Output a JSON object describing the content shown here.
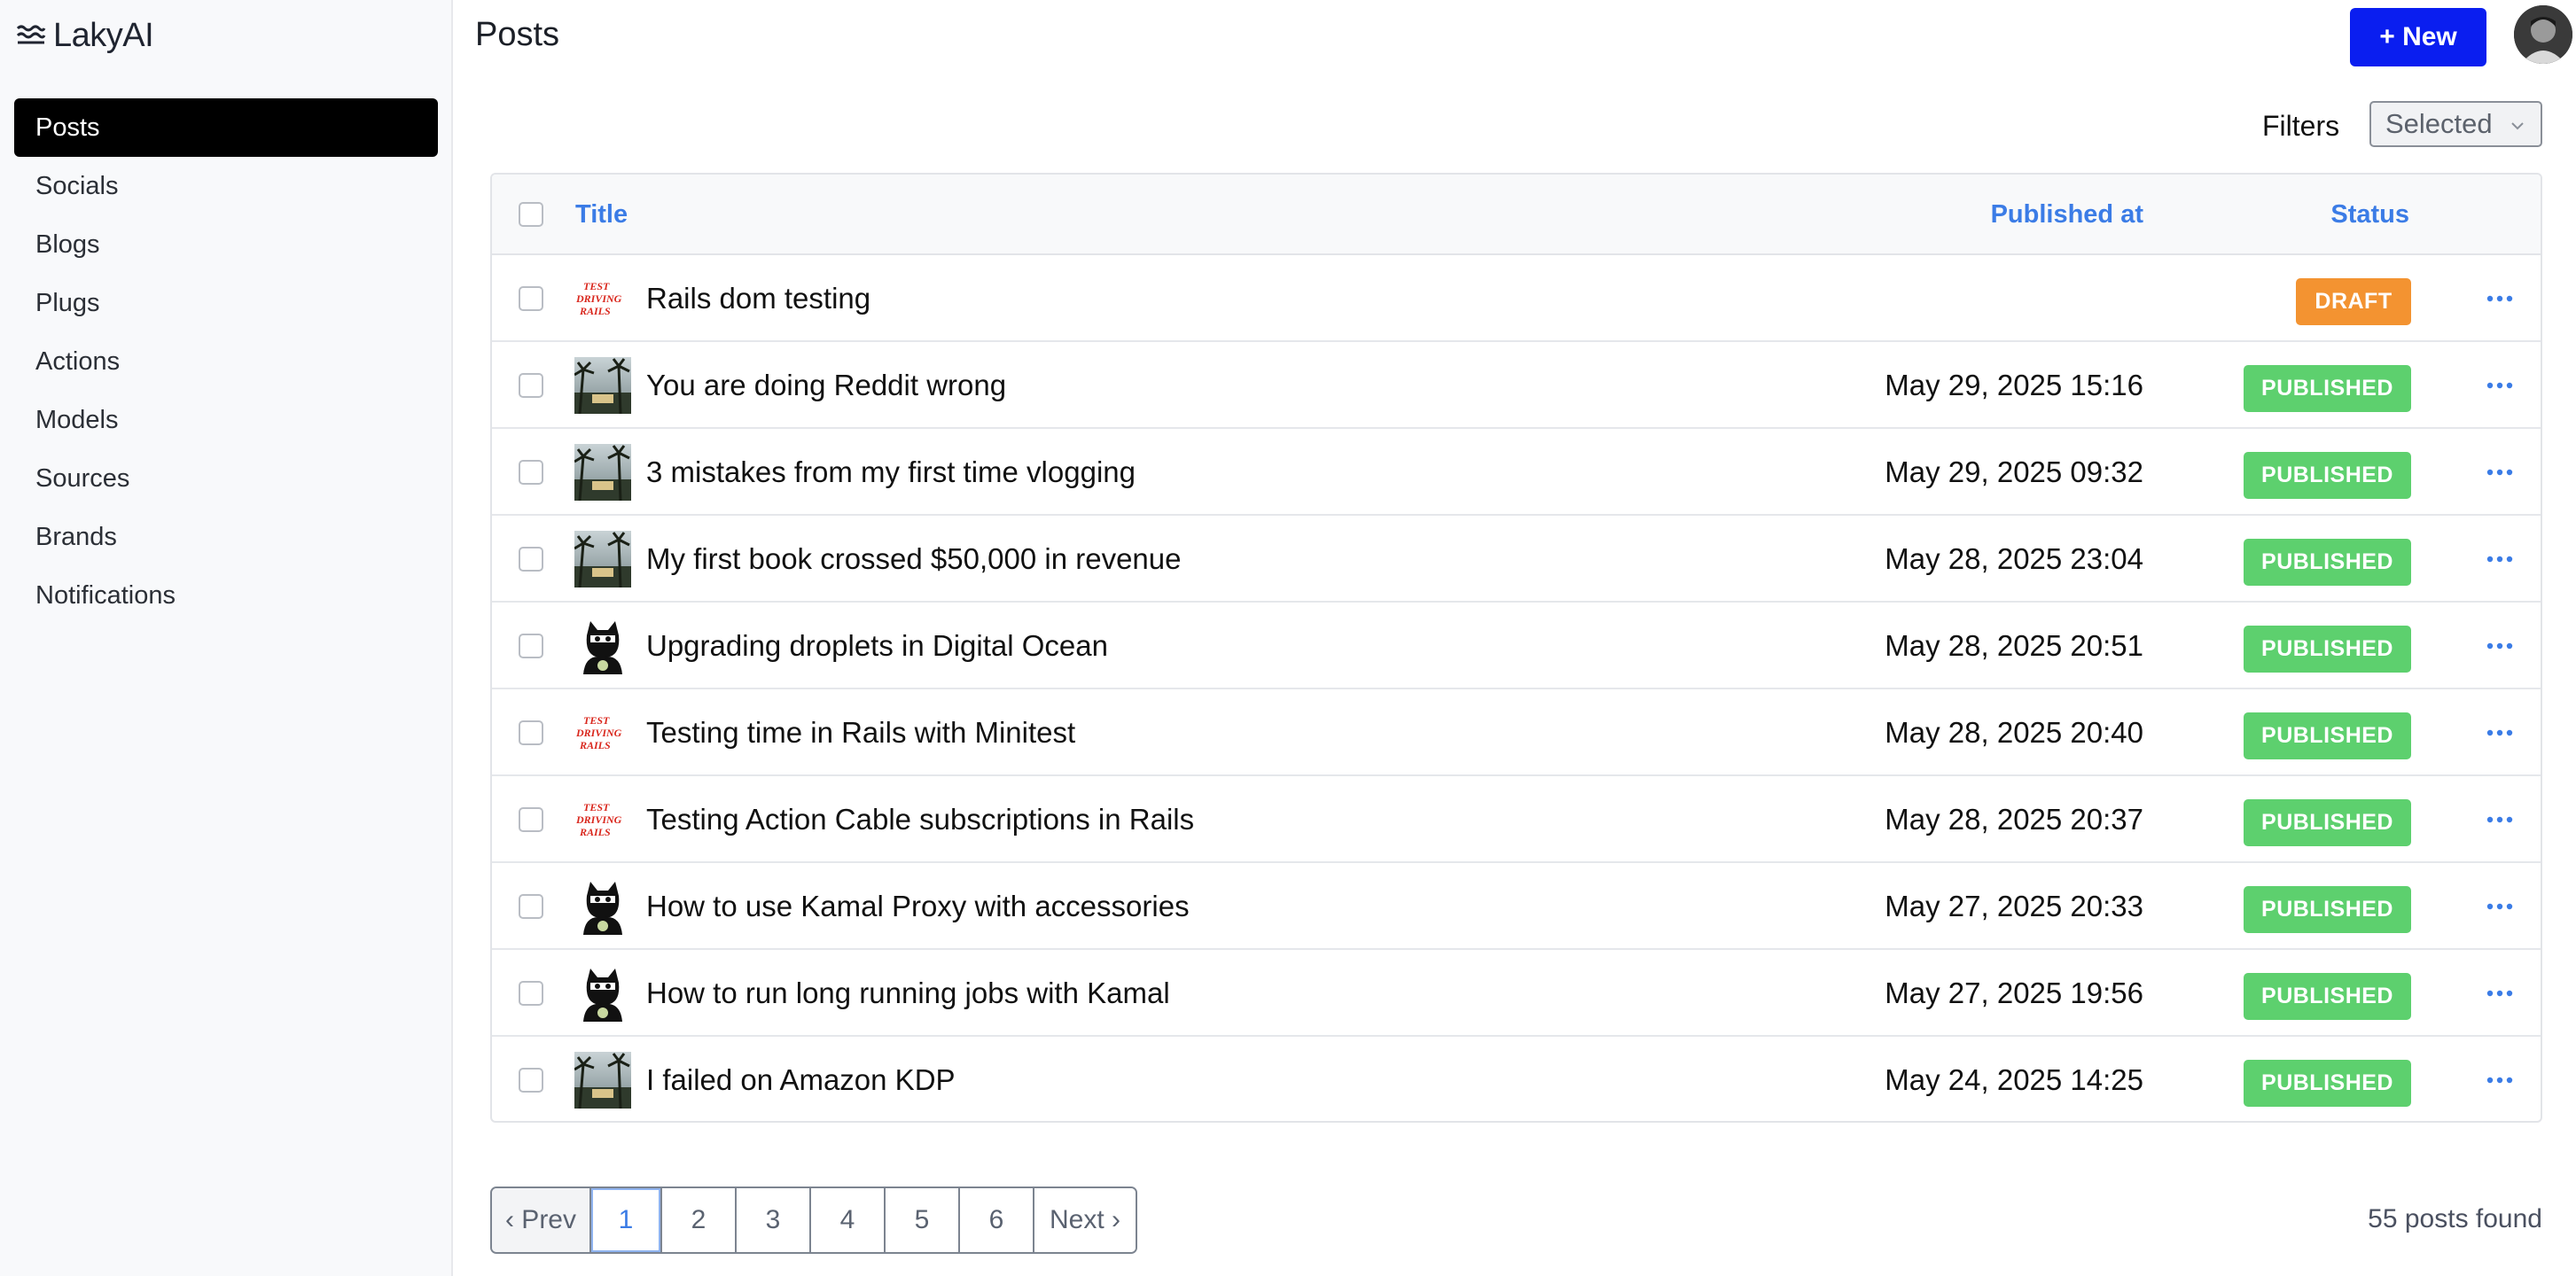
{
  "app": {
    "name": "LakyAI"
  },
  "sidebar": {
    "items": [
      {
        "label": "Posts",
        "active": true
      },
      {
        "label": "Socials"
      },
      {
        "label": "Blogs"
      },
      {
        "label": "Plugs"
      },
      {
        "label": "Actions"
      },
      {
        "label": "Models"
      },
      {
        "label": "Sources"
      },
      {
        "label": "Brands"
      },
      {
        "label": "Notifications"
      }
    ]
  },
  "header": {
    "title": "Posts",
    "new_button": "+ New"
  },
  "filters": {
    "label": "Filters",
    "selected": "Selected"
  },
  "table": {
    "columns": {
      "title": "Title",
      "published_at": "Published at",
      "status": "Status"
    },
    "rows": [
      {
        "thumb": "rails-logo",
        "title": "Rails dom testing",
        "published_at": "",
        "status": "DRAFT"
      },
      {
        "thumb": "palm-photo",
        "title": "You are doing Reddit wrong",
        "published_at": "May 29, 2025 15:16",
        "status": "PUBLISHED"
      },
      {
        "thumb": "palm-photo",
        "title": "3 mistakes from my first time vlogging",
        "published_at": "May 29, 2025 09:32",
        "status": "PUBLISHED"
      },
      {
        "thumb": "palm-photo",
        "title": "My first book crossed $50,000 in revenue",
        "published_at": "May 28, 2025 23:04",
        "status": "PUBLISHED"
      },
      {
        "thumb": "cat-mascot",
        "title": "Upgrading droplets in Digital Ocean",
        "published_at": "May 28, 2025 20:51",
        "status": "PUBLISHED"
      },
      {
        "thumb": "rails-logo",
        "title": "Testing time in Rails with Minitest",
        "published_at": "May 28, 2025 20:40",
        "status": "PUBLISHED"
      },
      {
        "thumb": "rails-logo",
        "title": "Testing Action Cable subscriptions in Rails",
        "published_at": "May 28, 2025 20:37",
        "status": "PUBLISHED"
      },
      {
        "thumb": "cat-mascot",
        "title": "How to use Kamal Proxy with accessories",
        "published_at": "May 27, 2025 20:33",
        "status": "PUBLISHED"
      },
      {
        "thumb": "cat-mascot",
        "title": "How to run long running jobs with Kamal",
        "published_at": "May 27, 2025 19:56",
        "status": "PUBLISHED"
      },
      {
        "thumb": "palm-photo",
        "title": "I failed on Amazon KDP",
        "published_at": "May 24, 2025 14:25",
        "status": "PUBLISHED"
      }
    ],
    "thumb_texts": {
      "rails": [
        "TEST",
        "DRIVING",
        "RAILS"
      ]
    }
  },
  "pagination": {
    "prev": "‹ Prev",
    "pages": [
      "1",
      "2",
      "3",
      "4",
      "5",
      "6"
    ],
    "current": "1",
    "next": "Next ›"
  },
  "summary": {
    "posts_found": "55 posts found"
  },
  "colors": {
    "accent": "#0a1ef0",
    "link": "#3b7ce6",
    "published": "#5dd06e",
    "draft": "#f39331"
  }
}
